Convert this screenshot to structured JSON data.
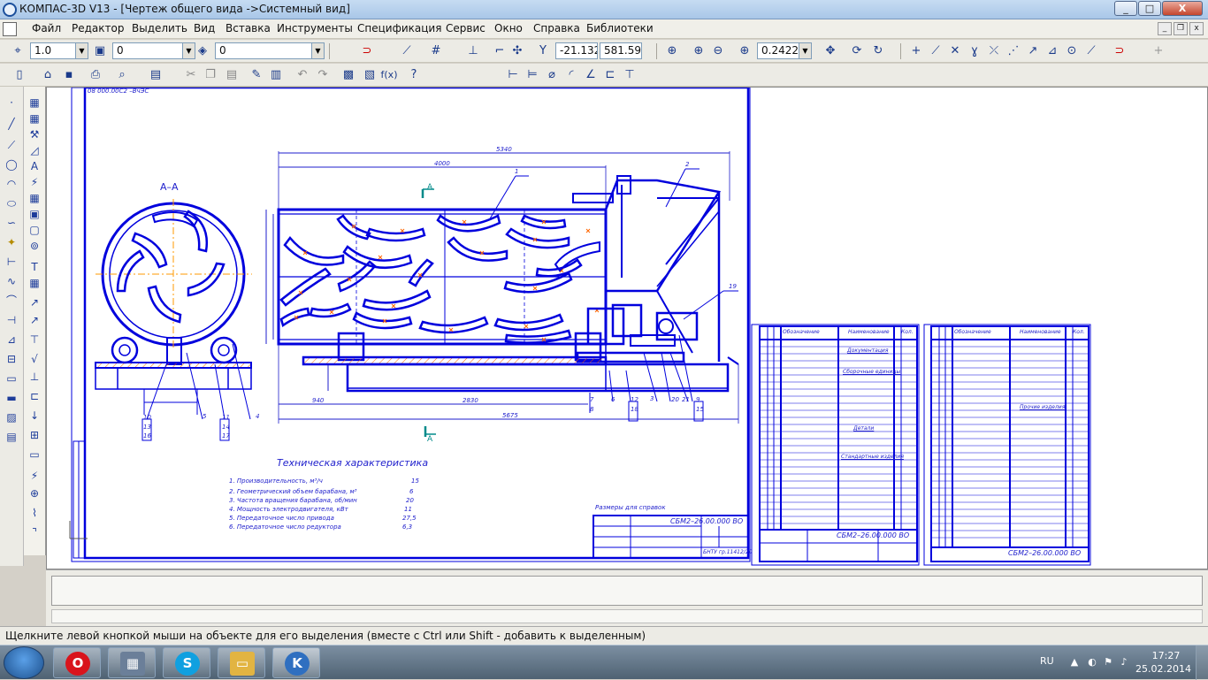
{
  "window": {
    "title": "КОМПАС-3D V13 - [Чертеж общего вида ->Системный вид]",
    "minimize_glyph": "_",
    "maximize_glyph": "□",
    "close_glyph": "X"
  },
  "menu": {
    "items": [
      "Файл",
      "Редактор",
      "Выделить",
      "Вид",
      "Вставка",
      "Инструменты",
      "Спецификация",
      "Сервис",
      "Окно",
      "Справка",
      "Библиотеки"
    ]
  },
  "toolbar1": {
    "step": "1.0",
    "layer": "0",
    "style": "0",
    "coord_x": "-21.132",
    "coord_y": "581.59",
    "zoom": "0.2422"
  },
  "drawing": {
    "section_label": "А–А",
    "arrow_label_top": "А",
    "arrow_label_bottom": "А",
    "stamp_top_left": "08 000.00С2 –ВчЭС",
    "dim_overall": "5340",
    "dim_drum_len": "4000",
    "dim_base_left": "940",
    "dim_base_mid": "2830",
    "dim_base_total": "5675",
    "tech_title": "Техническая характеристика",
    "tech_items": [
      {
        "text": "1. Производительность, м³/ч",
        "value": "15"
      },
      {
        "text": "2. Геометрический объем барабана, м³",
        "value": "6"
      },
      {
        "text": "3. Частота вращения барабана, об/мин",
        "value": "20"
      },
      {
        "text": "4. Мощность электродвигателя, кВт",
        "value": "11"
      },
      {
        "text": "5. Передаточное число привода",
        "value": "27,5"
      },
      {
        "text": "6. Передаточное число редуктора",
        "value": "6,3"
      }
    ],
    "ref_note": "Размеры для справок",
    "title_block_code": "СБМ2–26.00.000 ВО",
    "title_block_school": "БНТУ гр.11412/20",
    "spec1_code": "СБМ2–26.00.000 ВО",
    "spec2_code": "СБМ2–26.00.000 ВО",
    "spec_headers": [
      "Обозначение",
      "Наименование",
      "Кол."
    ],
    "spec1_sections": [
      "Документация",
      "Сборочные единицы",
      "Детали",
      "Стандартные изделия"
    ],
    "spec2_sections": [
      "Прочие изделия"
    ],
    "leader_numbers": [
      "1",
      "2",
      "3",
      "4",
      "5",
      "6",
      "7",
      "8",
      "9",
      "10",
      "11",
      "12",
      "13",
      "14",
      "15",
      "16",
      "17",
      "18",
      "19",
      "20",
      "21"
    ]
  },
  "status": {
    "hint": "Щелкните левой кнопкой мыши на объекте для его выделения (вместе с Ctrl или Shift - добавить к выделенным)"
  },
  "taskbar": {
    "apps": [
      {
        "name": "opera",
        "glyph": "O",
        "color": "#d9141c"
      },
      {
        "name": "calculator",
        "glyph": "▦",
        "color": "#6b7f99"
      },
      {
        "name": "skype",
        "glyph": "S",
        "color": "#10a0e0"
      },
      {
        "name": "explorer",
        "glyph": "▭",
        "color": "#e2b442"
      },
      {
        "name": "kompas",
        "glyph": "K",
        "color": "#2f6fc0"
      }
    ],
    "lang": "RU",
    "time": "17:27",
    "date": "25.02.2014"
  },
  "colors": {
    "line": "#0000dd",
    "dim": "#1e1ecc",
    "hatch": "#ff6600",
    "axis": "#ff9900"
  }
}
